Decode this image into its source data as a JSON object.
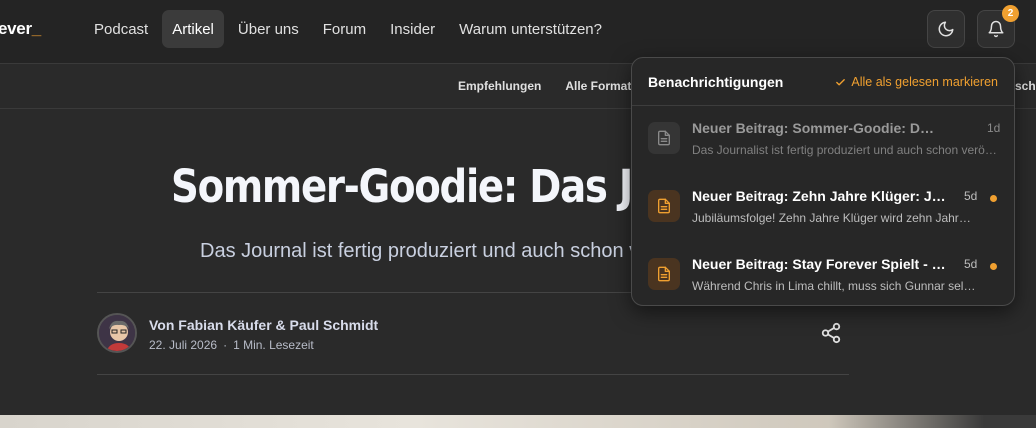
{
  "header": {
    "logo_text": "ever",
    "logo_dash": "_",
    "nav": [
      {
        "label": "Podcast",
        "active": false
      },
      {
        "label": "Artikel",
        "active": true
      },
      {
        "label": "Über uns",
        "active": false
      },
      {
        "label": "Forum",
        "active": false
      },
      {
        "label": "Insider",
        "active": false
      },
      {
        "label": "Warum unterstützen?",
        "active": false
      }
    ],
    "notification_count": "2"
  },
  "subnav": {
    "items": [
      "Empfehlungen",
      "Alle Formate"
    ],
    "right_partial": "sch"
  },
  "article": {
    "title": "Sommer-Goodie: Das Journal ist fertig",
    "subtitle": "Das Journal ist fertig produziert und auch schon veröffentlicht",
    "author": "Von Fabian Käufer & Paul Schmidt",
    "date": "22. Juli 2026",
    "separator": "·",
    "read_time": "1 Min. Lesezeit"
  },
  "notifications": {
    "title": "Benachrichtigungen",
    "mark_all_read": "Alle als gelesen markieren",
    "items": [
      {
        "title": "Neuer Beitrag: Sommer-Goodie: Das Journal ist fertig",
        "body": "Das Journalist ist fertig produziert und auch schon veröffentlicht",
        "time": "1d",
        "unread": false
      },
      {
        "title": "Neuer Beitrag: Zehn Jahre Klüger: Jubiläum",
        "body": "Jubiläumsfolge! Zehn Jahre Klüger wird zehn Jahre alt",
        "time": "5d",
        "unread": true
      },
      {
        "title": "Neuer Beitrag: Stay Forever Spielt - Das Spiel",
        "body": "Während Chris in Lima chillt, muss sich Gunnar selbst beschäftigen",
        "time": "5d",
        "unread": true
      }
    ]
  },
  "colors": {
    "accent": "#f0a030",
    "background": "#2a2a2a",
    "panel": "#272727"
  },
  "icons": {
    "theme_toggle": "moon-icon",
    "notifications": "bell-icon",
    "share": "share-icon",
    "mark_read": "check-icon",
    "notification_item": "document-icon"
  }
}
